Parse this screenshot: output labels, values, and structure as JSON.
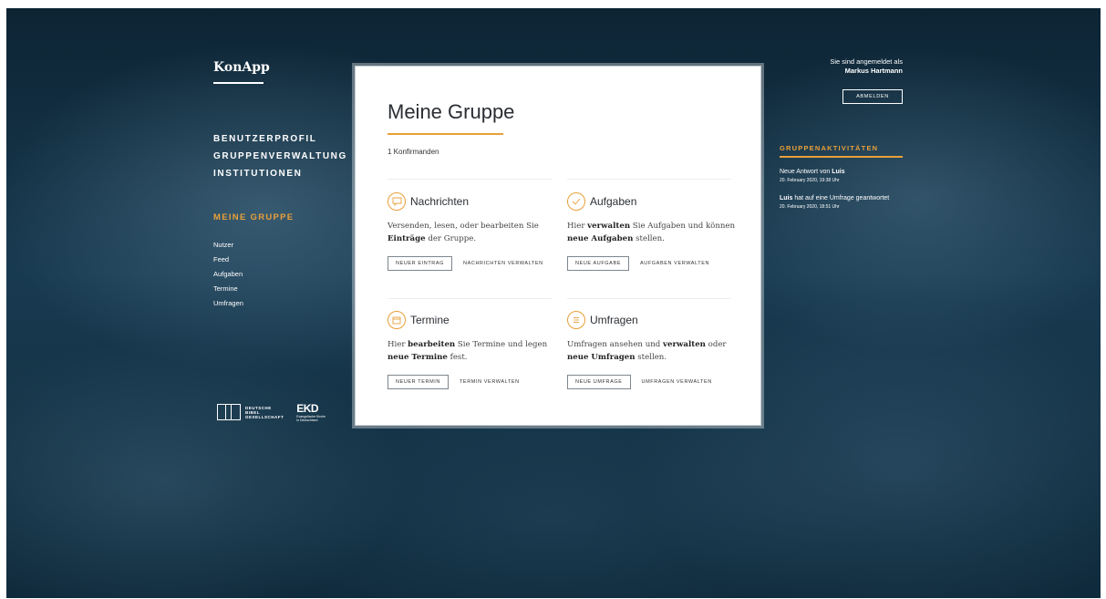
{
  "brand": "KonApp",
  "nav": {
    "main": [
      "BENUTZERPROFIL",
      "GRUPPENVERWALTUNG",
      "INSTITUTIONEN"
    ],
    "section_title": "MEINE GRUPPE",
    "sub": [
      "Nutzer",
      "Feed",
      "Aufgaben",
      "Termine",
      "Umfragen"
    ]
  },
  "logos": {
    "bibel_lines": [
      "DEUTSCHE",
      "BIBEL",
      "GESELLSCHAFT"
    ],
    "ekd_mark": "EKD",
    "ekd_lines": [
      "Evangelische Kirche",
      "in Deutschland"
    ]
  },
  "main": {
    "title": "Meine Gruppe",
    "count": "1 Konfirmanden",
    "sections": {
      "nachrichten": {
        "title": "Nachrichten",
        "desc_a": "Versenden, lesen, oder bearbeiten Sie ",
        "desc_b": "Einträge",
        "desc_c": " der Gruppe.",
        "btn_new": "NEUER EINTRAG",
        "btn_manage": "NACHRICHTEN VERWALTEN"
      },
      "aufgaben": {
        "title": "Aufgaben",
        "desc_a": "Hier ",
        "desc_b": "verwalten",
        "desc_c": " Sie Aufgaben und können ",
        "desc_d": "neue Aufgaben",
        "desc_e": " stellen.",
        "btn_new": "NEUE AUFGABE",
        "btn_manage": "AUFGABEN VERWALTEN"
      },
      "termine": {
        "title": "Termine",
        "desc_a": "Hier ",
        "desc_b": "bearbeiten",
        "desc_c": " Sie Termine und legen ",
        "desc_d": "neue Termine",
        "desc_e": " fest.",
        "btn_new": "NEUER TERMIN",
        "btn_manage": "TERMIN VERWALTEN"
      },
      "umfragen": {
        "title": "Umfragen",
        "desc_a": "Umfragen ansehen und ",
        "desc_b": "verwalten",
        "desc_c": " oder ",
        "desc_d": "neue Umfragen",
        "desc_e": " stellen.",
        "btn_new": "NEUE UMFRAGE",
        "btn_manage": "UMFRAGEN VERWALTEN"
      }
    }
  },
  "user": {
    "logged_in_label": "Sie sind angemeldet als",
    "name": "Markus Hartmann",
    "logout": "ABMELDEN"
  },
  "activities": {
    "title": "GRUPPENAKTIVITÄTEN",
    "items": [
      {
        "prefix": "Neue Antwort von ",
        "bold": "Luis",
        "suffix": "",
        "time": "20. February 2020, 19:38 Uhr"
      },
      {
        "prefix": "",
        "bold": "Luis",
        "suffix": " hat auf eine Umfrage geantwortet",
        "time": "20. February 2020, 18:51 Uhr"
      }
    ]
  },
  "icons": {
    "nachrichten": "speech-bubble-icon",
    "aufgaben": "checkmark-icon",
    "termine": "calendar-icon",
    "umfragen": "list-icon"
  },
  "colors": {
    "accent": "#e8a03a",
    "background": "#183a50",
    "card": "#ffffff"
  }
}
